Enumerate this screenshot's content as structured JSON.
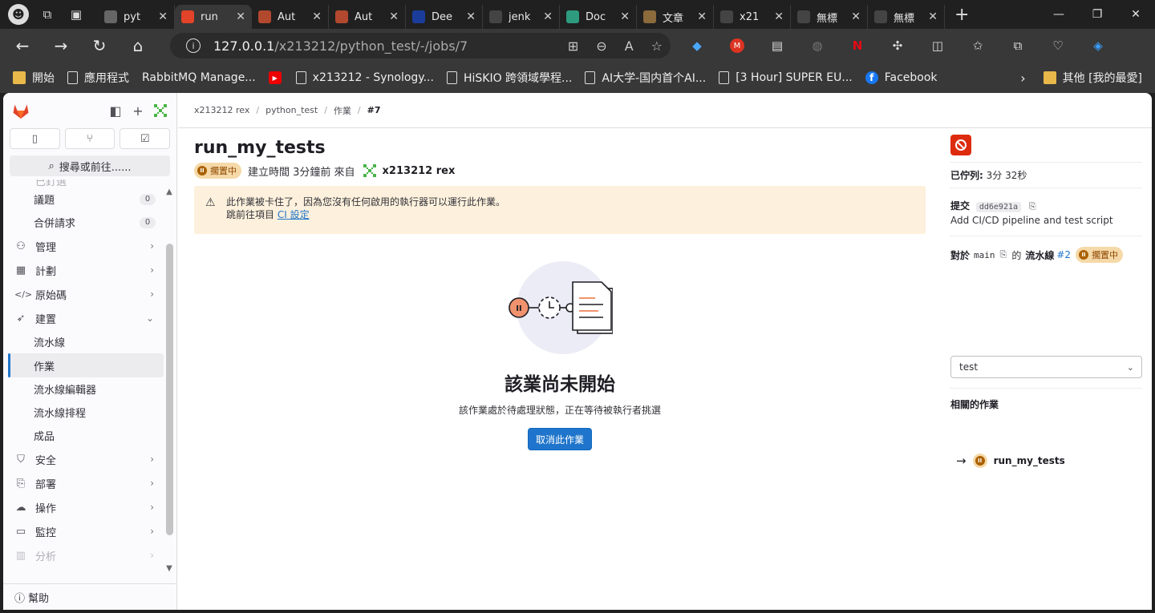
{
  "browser": {
    "tabs": [
      {
        "label": "pyt",
        "fav_color": "#666",
        "active": false
      },
      {
        "label": "run",
        "fav_color": "#e24329",
        "active": true
      },
      {
        "label": "Aut",
        "fav_color": "#b2482e",
        "active": false
      },
      {
        "label": "Aut",
        "fav_color": "#b2482e",
        "active": false
      },
      {
        "label": "Dee",
        "fav_color": "#1a3d9c",
        "active": false
      },
      {
        "label": "jenk",
        "fav_color": "#444",
        "active": false
      },
      {
        "label": "Doc",
        "fav_color": "#2e9b7f",
        "active": false
      },
      {
        "label": "文章",
        "fav_color": "#8b6a3b",
        "active": false
      },
      {
        "label": "x21",
        "fav_color": "#444",
        "active": false
      },
      {
        "label": "無標",
        "fav_color": "#444",
        "active": false
      },
      {
        "label": "無標",
        "fav_color": "#444",
        "active": false
      }
    ],
    "url_host": "127.0.0.1",
    "url_path": "/x213212/python_test/-/jobs/7",
    "bookmarks": [
      "開始",
      "應用程式",
      "RabbitMQ Manage...",
      "x213212 - Synology...",
      "HiSKIO 跨領域學程...",
      "AI大学-国内首个AI...",
      "[3 Hour] SUPER EU...",
      "Facebook"
    ],
    "bookmarks_other": "其他 [我的最愛]"
  },
  "sidebar": {
    "search_label": "搜尋或前往......",
    "faded_top": "已釘選",
    "issues_label": "議題",
    "issues_count": "0",
    "mr_label": "合併請求",
    "mr_count": "0",
    "items": [
      {
        "label": "管理",
        "icon": "users-icon"
      },
      {
        "label": "計劃",
        "icon": "calendar-icon"
      },
      {
        "label": "原始碼",
        "icon": "code-icon"
      },
      {
        "label": "建置",
        "icon": "rocket-icon"
      }
    ],
    "build_sub": [
      "流水線",
      "作業",
      "流水線編輯器",
      "流水線排程",
      "成品"
    ],
    "items2": [
      {
        "label": "安全",
        "icon": "shield-icon"
      },
      {
        "label": "部署",
        "icon": "deploy-icon"
      },
      {
        "label": "操作",
        "icon": "cloud-icon"
      },
      {
        "label": "監控",
        "icon": "monitor-icon"
      }
    ],
    "faded_bottom": "分析",
    "help_label": "幫助"
  },
  "breadcrumb": [
    "x213212 rex",
    "python_test",
    "作業",
    "#7"
  ],
  "job": {
    "title": "run_my_tests",
    "status": "擱置中",
    "created_text": "建立時間 3分鐘前 來自",
    "user": "x213212 rex"
  },
  "alert": {
    "line1": "此作業被卡住了，因為您沒有任何啟用的執行器可以運行此作業。",
    "line2_prefix": "跳前往項目",
    "line2_link": "CI 設定"
  },
  "empty_state": {
    "title": "該業尚未開始",
    "description": "該作業處於待處理狀態，正在等待被執行者挑選",
    "cancel_button": "取消此作業"
  },
  "right_panel": {
    "queued_label": "已佇列:",
    "queued_value": "3分 32秒",
    "commit_label": "提交",
    "commit_sha": "dd6e921a",
    "commit_message": "Add CI/CD pipeline and test script",
    "for_label": "對於",
    "branch": "main",
    "of_label": "的",
    "pipeline_label": "流水線",
    "pipeline_id": "#2",
    "pipeline_status": "擱置中",
    "stage_select": "test",
    "related_jobs_label": "相關的作業",
    "related_job": "run_my_tests"
  },
  "colors": {
    "accent": "#1f75cb",
    "pending_bg": "#f5d9a8",
    "pending_fg": "#ab6100",
    "danger": "#dd2b0e"
  }
}
